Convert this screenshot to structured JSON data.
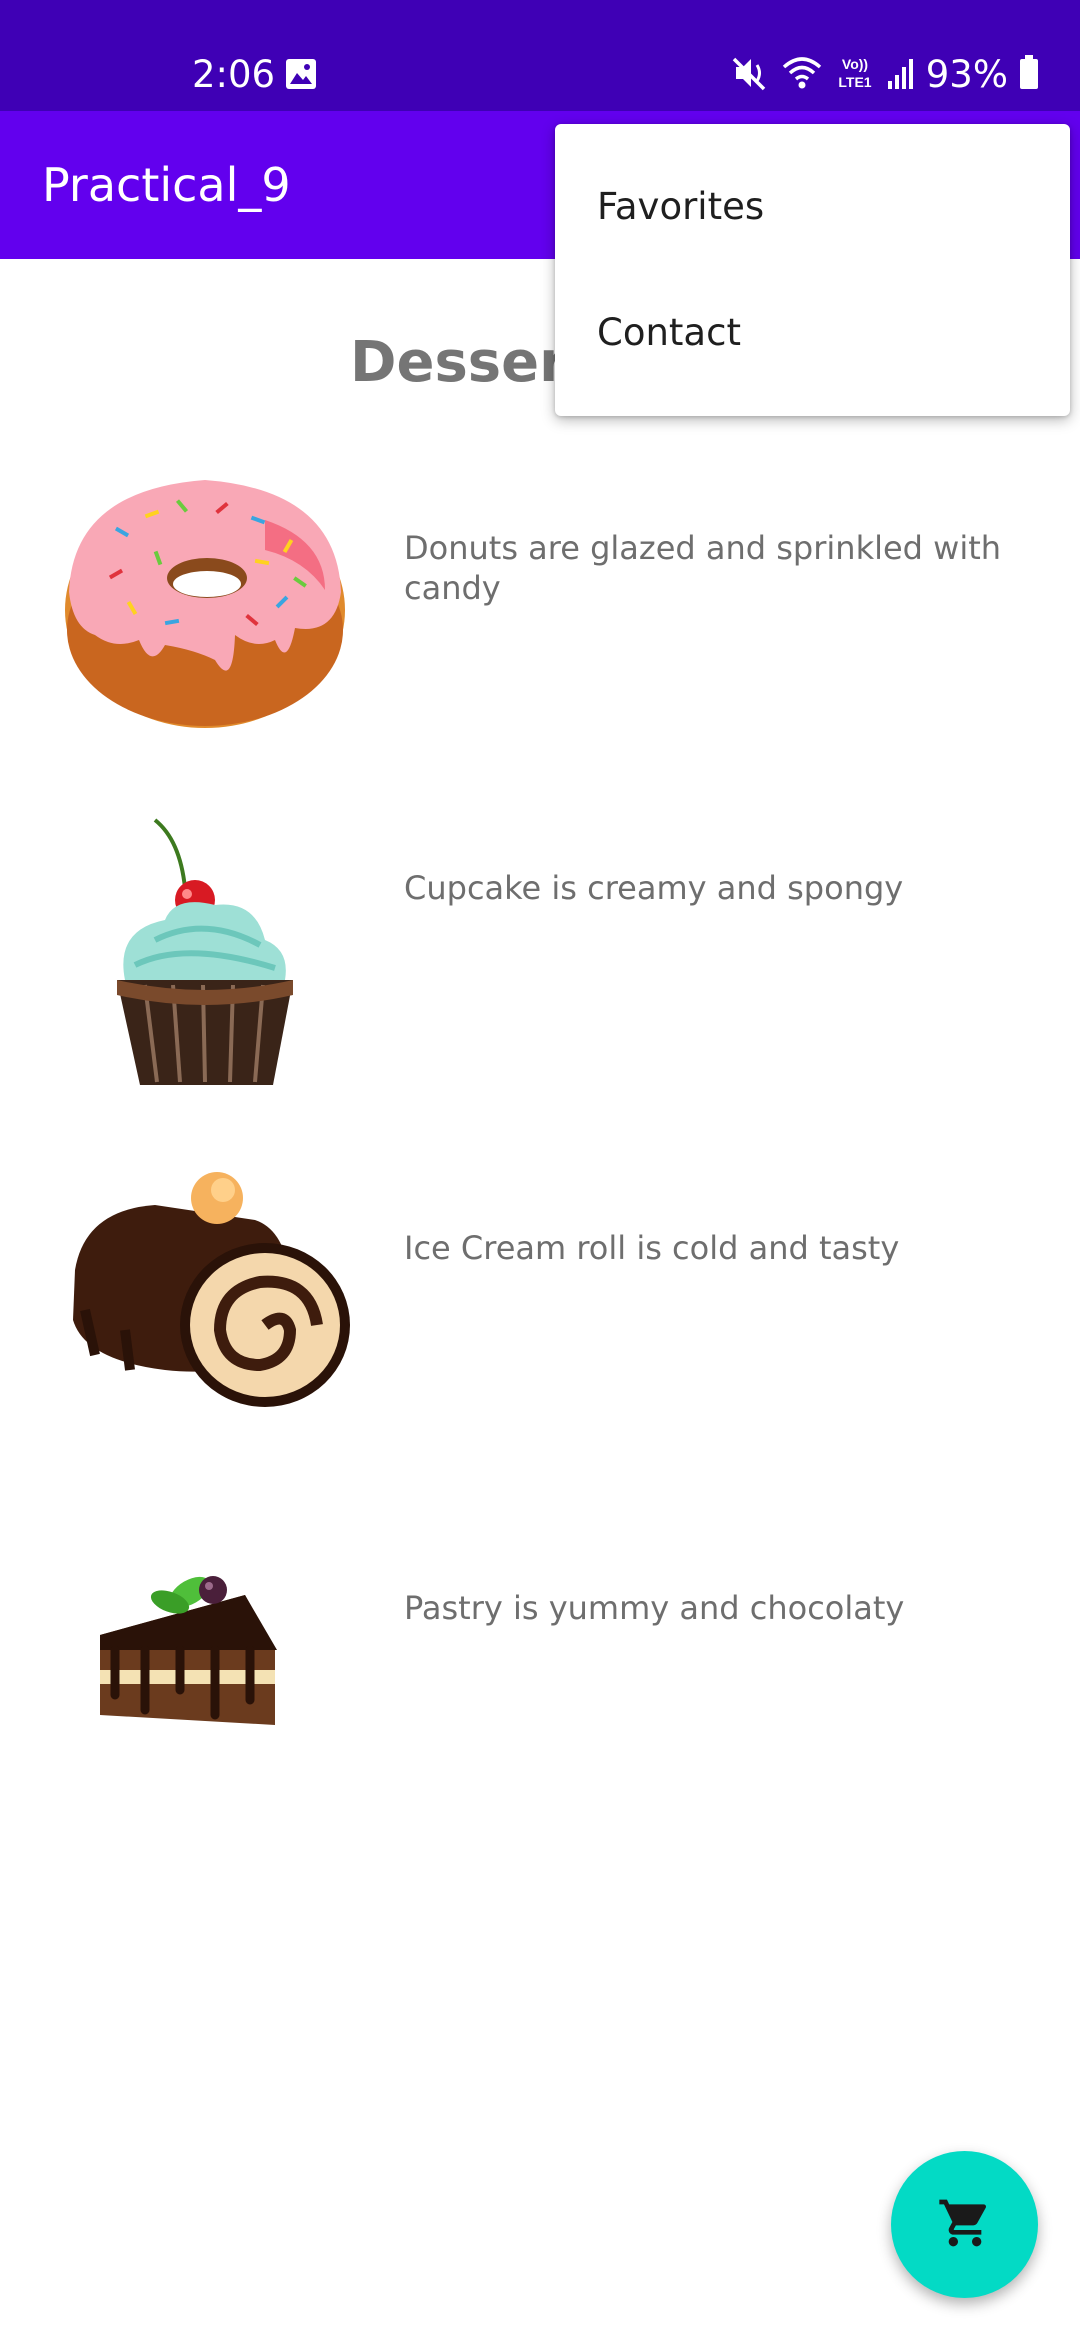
{
  "status_bar": {
    "time": "2:06",
    "battery_text": "93%",
    "icons": [
      "gallery-icon",
      "mute-icon",
      "wifi-icon",
      "volte-icon",
      "signal-icon",
      "battery-icon"
    ]
  },
  "app_bar": {
    "title": "Practical_9",
    "background": "#6200ee",
    "status_bar_color": "#3f00b5"
  },
  "page": {
    "heading": "Desserts"
  },
  "desserts": [
    {
      "image": "donut-image",
      "description": "Donuts are glazed and sprinkled with candy"
    },
    {
      "image": "cupcake-image",
      "description": "Cupcake is creamy and spongy"
    },
    {
      "image": "ice-cream-roll-image",
      "description": "Ice Cream roll is cold and tasty"
    },
    {
      "image": "pastry-image",
      "description": "Pastry is yummy and chocolaty"
    }
  ],
  "overflow_menu": {
    "items": [
      {
        "label": "Favorites"
      },
      {
        "label": "Contact"
      }
    ]
  },
  "fab": {
    "icon": "cart-icon",
    "color": "#03dac5"
  }
}
